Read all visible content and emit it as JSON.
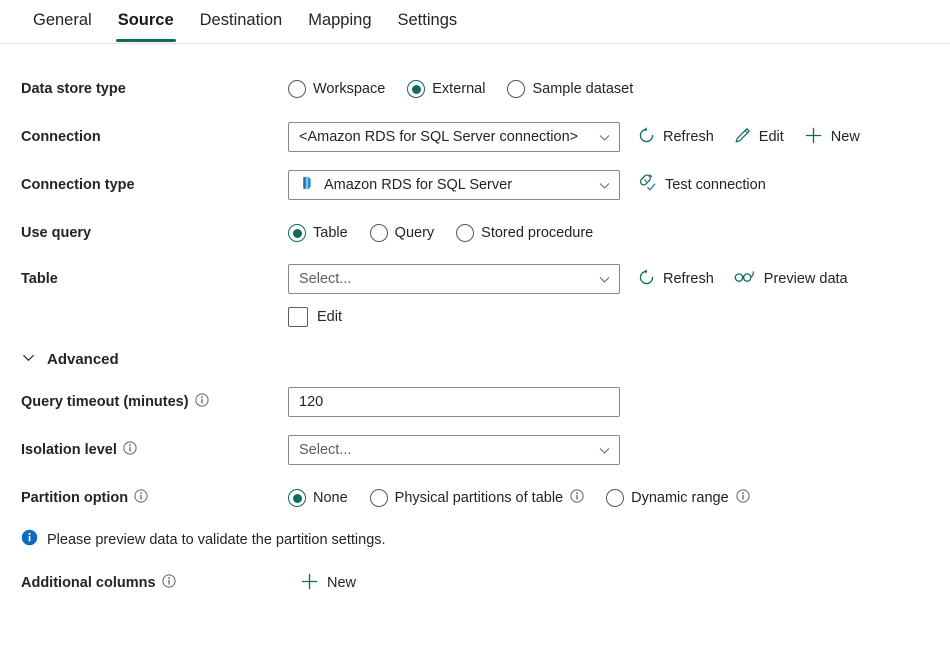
{
  "accent": "#0f6b5c",
  "info_blue": "#0f6cbd",
  "tabs": [
    {
      "label": "General",
      "active": false
    },
    {
      "label": "Source",
      "active": true
    },
    {
      "label": "Destination",
      "active": false
    },
    {
      "label": "Mapping",
      "active": false
    },
    {
      "label": "Settings",
      "active": false
    }
  ],
  "data_store_type": {
    "label": "Data store type",
    "options": [
      {
        "label": "Workspace",
        "selected": false
      },
      {
        "label": "External",
        "selected": true
      },
      {
        "label": "Sample dataset",
        "selected": false
      }
    ]
  },
  "connection": {
    "label": "Connection",
    "value": "<Amazon RDS for SQL Server connection>",
    "refresh_label": "Refresh",
    "edit_label": "Edit",
    "new_label": "New"
  },
  "connection_type": {
    "label": "Connection type",
    "value": "Amazon RDS for SQL Server",
    "test_label": "Test connection"
  },
  "use_query": {
    "label": "Use query",
    "options": [
      {
        "label": "Table",
        "selected": true
      },
      {
        "label": "Query",
        "selected": false
      },
      {
        "label": "Stored procedure",
        "selected": false
      }
    ]
  },
  "table": {
    "label": "Table",
    "placeholder": "Select...",
    "value": "",
    "refresh_label": "Refresh",
    "preview_label": "Preview data",
    "edit_checkbox_label": "Edit",
    "edit_checked": false
  },
  "advanced": {
    "label": "Advanced",
    "expanded": true
  },
  "query_timeout": {
    "label": "Query timeout (minutes)",
    "value": "120",
    "has_info": true
  },
  "isolation_level": {
    "label": "Isolation level",
    "placeholder": "Select...",
    "value": "",
    "has_info": true
  },
  "partition_option": {
    "label": "Partition option",
    "has_info": true,
    "options": [
      {
        "label": "None",
        "selected": true,
        "has_info": false
      },
      {
        "label": "Physical partitions of table",
        "selected": false,
        "has_info": true
      },
      {
        "label": "Dynamic range",
        "selected": false,
        "has_info": true
      }
    ]
  },
  "message": {
    "text": "Please preview data to validate the partition settings.",
    "icon": "info-filled-icon"
  },
  "additional_columns": {
    "label": "Additional columns",
    "has_info": true,
    "new_label": "New"
  }
}
